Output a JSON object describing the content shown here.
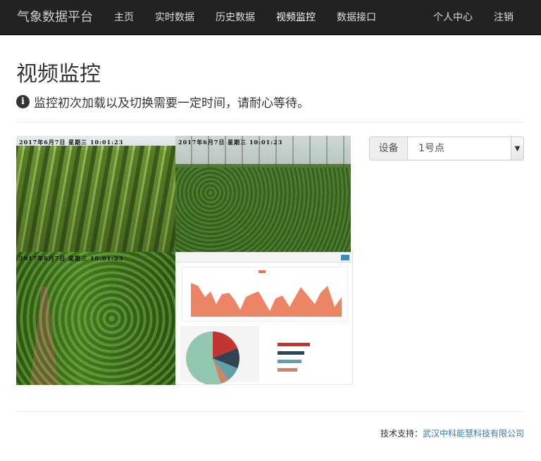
{
  "navbar": {
    "brand": "气象数据平台",
    "left_items": [
      "主页",
      "实时数据",
      "历史数据",
      "视频监控",
      "数据接口"
    ],
    "right_items": [
      "个人中心",
      "注销"
    ]
  },
  "page": {
    "title": "视频监控",
    "notice": "监控初次加载以及切换需要一定时间，请耐心等待。",
    "info_icon": "info-circle-icon"
  },
  "cameras": [
    {
      "timestamp": "2017年6月7日  星期三  10:01:23"
    },
    {
      "timestamp": "2017年6月7日  星期三  10:01:23"
    },
    {
      "timestamp": "2017年6月7日  星期三  10:01:23"
    }
  ],
  "device": {
    "label": "设备",
    "selected": "1号点"
  },
  "footer": {
    "prefix": "技术支持：",
    "company": "武汉中科能慧科技有限公司"
  },
  "colors": {
    "navbar_bg": "#222222",
    "link": "#337ab7",
    "area_fill": "#e8704a"
  }
}
